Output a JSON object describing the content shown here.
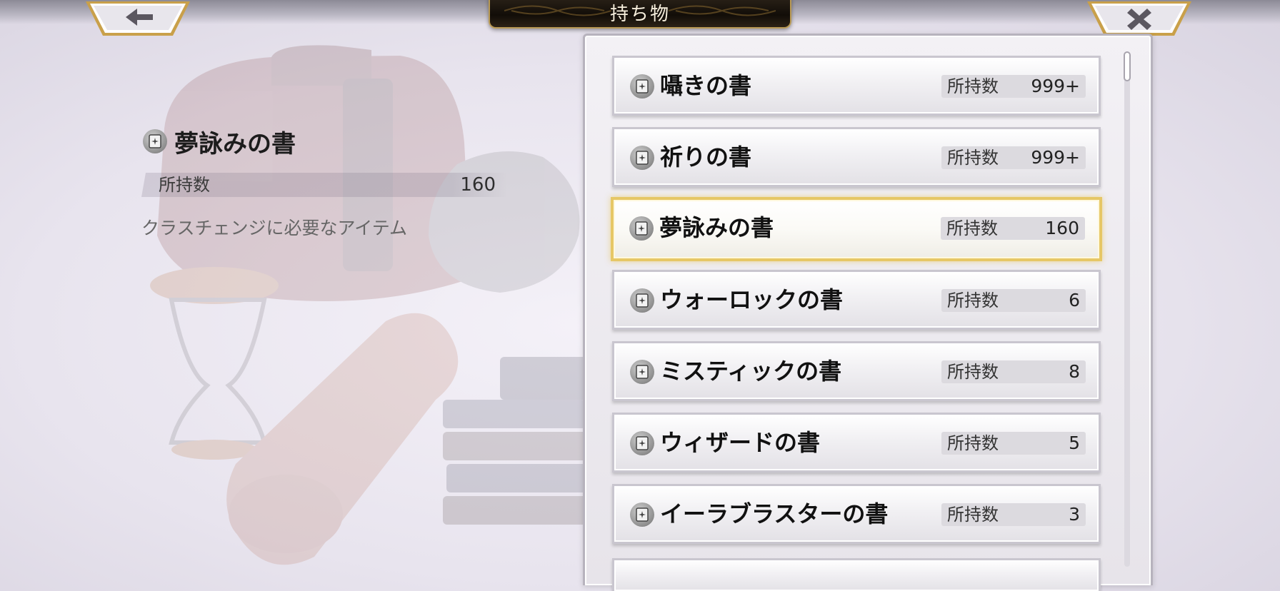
{
  "header": {
    "title": "持ち物",
    "back_icon": "arrow-left-icon",
    "close_icon": "close-icon"
  },
  "detail": {
    "icon": "book-icon",
    "name": "夢詠みの書",
    "qty_label": "所持数",
    "qty_value": "160",
    "description": "クラスチェンジに必要なアイテム"
  },
  "items": [
    {
      "name": "囁きの書",
      "qty_label": "所持数",
      "qty": "999+",
      "selected": false
    },
    {
      "name": "祈りの書",
      "qty_label": "所持数",
      "qty": "999+",
      "selected": false
    },
    {
      "name": "夢詠みの書",
      "qty_label": "所持数",
      "qty": "160",
      "selected": true
    },
    {
      "name": "ウォーロックの書",
      "qty_label": "所持数",
      "qty": "6",
      "selected": false
    },
    {
      "name": "ミスティックの書",
      "qty_label": "所持数",
      "qty": "8",
      "selected": false
    },
    {
      "name": "ウィザードの書",
      "qty_label": "所持数",
      "qty": "5",
      "selected": false
    },
    {
      "name": "イーラブラスターの書",
      "qty_label": "所持数",
      "qty": "3",
      "selected": false
    }
  ],
  "colors": {
    "accent_gold": "#e6c766",
    "title_plate": "#1a140d"
  }
}
